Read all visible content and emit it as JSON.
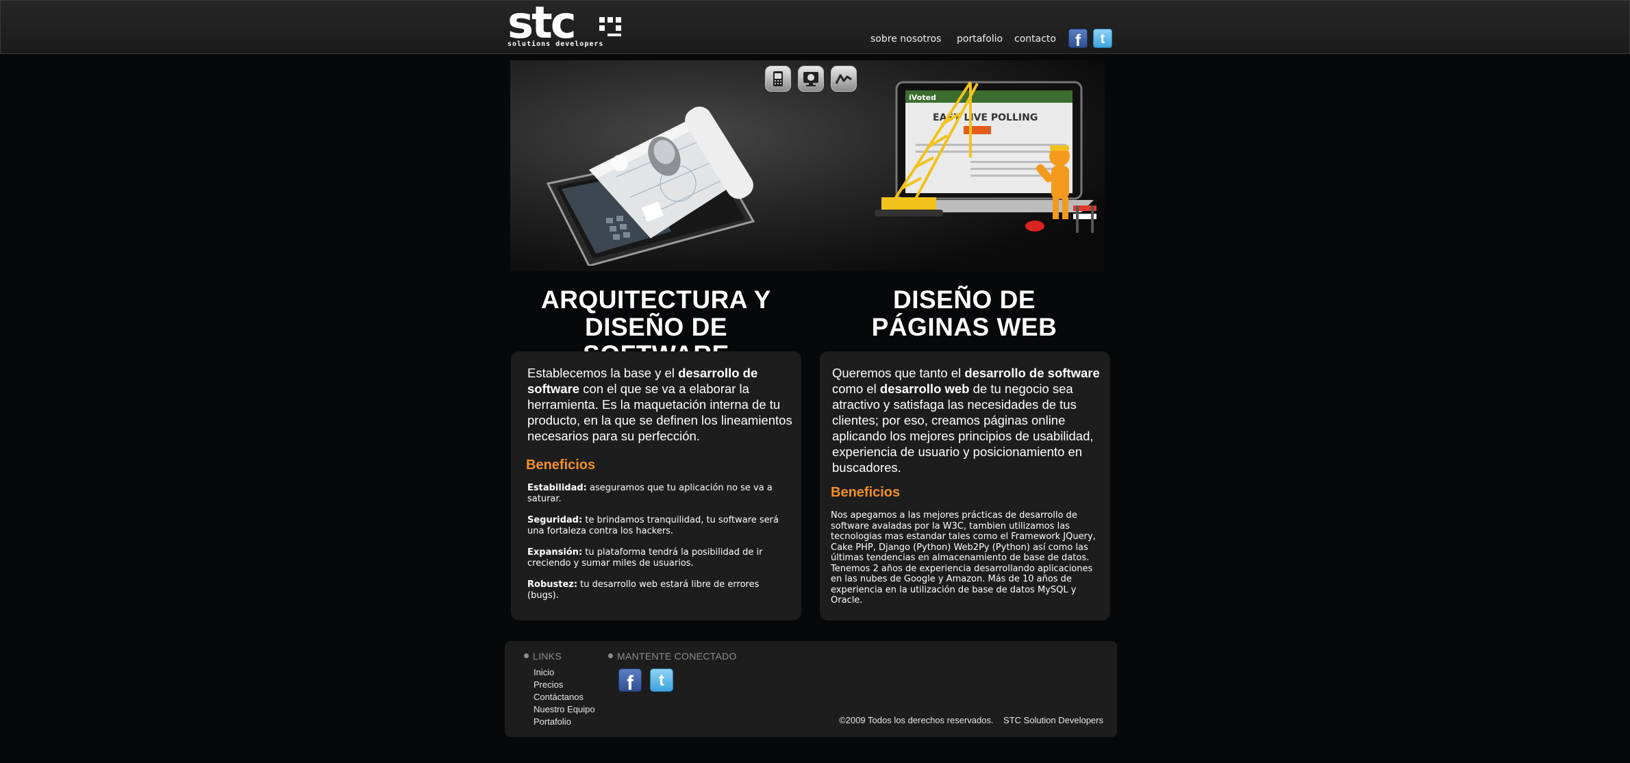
{
  "header": {
    "logo_text": "stc",
    "logo_subtitle": "solutions developers",
    "nav": [
      "sobre nosotros",
      "portafolio",
      "contacto"
    ],
    "social": [
      "facebook-icon",
      "twitter-icon"
    ]
  },
  "hero": {
    "icons": [
      "mobile-icon",
      "monitor-icon",
      "chart-line-icon"
    ],
    "left_image": "tablet-with-blueprint-illustration",
    "right_image": "laptop-under-construction-illustration",
    "laptop_screen_text": "EASY LIVE POLLING"
  },
  "columns": [
    {
      "title_line1": "ARQUITECTURA Y",
      "title_line2": "DISEÑO DE SOFTWARE",
      "lead": {
        "t1": "Establecemos la base y el ",
        "b1": "desarrollo de software",
        "t2": " con el que se va a elaborar la herramienta. Es la maquetación interna de tu producto, en la que se definen los lineamientos necesarios para su perfección."
      },
      "benefits_title": "Beneficios",
      "benefits": [
        {
          "term": "Estabilidad:",
          "text": " aseguramos que tu aplicación no se va a saturar."
        },
        {
          "term": "Seguridad:",
          "text": " te brindamos tranquilidad, tu software será una fortaleza contra los hackers."
        },
        {
          "term": "Expansión:",
          "text": " tu plataforma tendrá la posibilidad de ir creciendo y sumar miles de usuarios."
        },
        {
          "term": "Robustez:",
          "text": " tu desarrollo web estará libre de errores (bugs)."
        }
      ]
    },
    {
      "title_line1": "DISEÑO DE",
      "title_line2": "PÁGINAS WEB",
      "lead": {
        "t1": "Queremos que tanto el ",
        "b1": "desarrollo de software",
        "t2": " como el ",
        "b2": "desarrollo web",
        "t3": " de tu negocio sea atractivo y satisfaga las necesidades de tus clientes; por eso, creamos páginas online aplicando los mejores principios de usabilidad, experiencia de usuario y posicionamiento en buscadores."
      },
      "benefits_title": "Beneficios",
      "benefits_text": "Nos apegamos a las mejores prácticas de desarrollo de software avaladas por la W3C, tambien utilizamos las tecnologias mas estandar tales como el Framework JQuery, Cake PHP, Django (Python) Web2Py (Python) así como las últimas tendencias en almacenamiento de base de datos. Tenemos 2 años de experiencia desarrollando aplicaciones en las nubes de Google y Amazon. Más de 10 años de experiencia en la utilización de base de datos MySQL y Oracle."
    }
  ],
  "footer": {
    "links_title": "LINKS",
    "links": [
      "Inicio",
      "Precios",
      "Contáctanos",
      "Nuestro Equipo",
      "Portafolio"
    ],
    "connect_title": "MANTENTE CONECTADO",
    "copyright": "©2009 Todos los derechos reservados.",
    "company": "STC Solution Developers"
  },
  "colors": {
    "background": "#070809",
    "panel": "#1d1d1d",
    "accent": "#f0902a"
  }
}
